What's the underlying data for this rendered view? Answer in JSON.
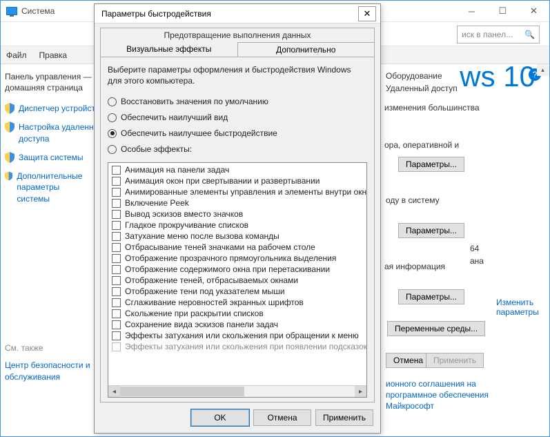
{
  "bg": {
    "title": "Система",
    "search_placeholder": "иск в панел...",
    "menu": {
      "file": "Файл",
      "edit": "Правка"
    },
    "left": {
      "home": "Панель управления —\nдомашняя страница",
      "items": [
        "Диспетчер устройств",
        "Настройка удаленного\nдоступа",
        "Защита системы",
        "Дополнительные параметры\nсистемы"
      ],
      "seealso": "См. также",
      "bottom": "Центр безопасности и\nобслуживания"
    },
    "right": {
      "tabs": [
        "Оборудование",
        "Удаленный доступ"
      ],
      "snip1": "изменения большинства",
      "snip2": "ора, оперативной и",
      "btn1": "Параметры...",
      "snip3": "оду в систему",
      "btn2": "Параметры...",
      "snip4": "ая информация",
      "btn3": "Параметры...",
      "snip5": "64",
      "snip6": "ана",
      "link_change": "Изменить\nпараметры",
      "env_btn": "Переменные среды...",
      "apply_cancel": "Отмена",
      "apply_apply": "Применить",
      "license1": "ионного соглашения на",
      "license2": "программное обеспечения",
      "license3": "Майкрософт",
      "w10": "ws 10"
    }
  },
  "modal": {
    "title": "Параметры быстродействия",
    "tab_dep": "Предотвращение выполнения данных",
    "tab_visual": "Визуальные эффекты",
    "tab_adv": "Дополнительно",
    "desc": "Выберите параметры оформления и быстродействия Windows для этого компьютера.",
    "radios": [
      {
        "label": "Восстановить значения по умолчанию",
        "checked": false
      },
      {
        "label": "Обеспечить наилучший вид",
        "checked": false
      },
      {
        "label": "Обеспечить наилучшее быстродействие",
        "checked": true
      },
      {
        "label": "Особые эффекты:",
        "checked": false
      }
    ],
    "checks": [
      "Анимация на панели задач",
      "Анимация окон при свертывании и развертывании",
      "Анимированные элементы управления и элементы внутри окна",
      "Включение Peek",
      "Вывод эскизов вместо значков",
      "Гладкое прокручивание списков",
      "Затухание меню после вызова команды",
      "Отбрасывание теней значками на рабочем столе",
      "Отображение прозрачного прямоугольника выделения",
      "Отображение содержимого окна при перетаскивании",
      "Отображение теней, отбрасываемых окнами",
      "Отображение тени под указателем мыши",
      "Сглаживание неровностей экранных шрифтов",
      "Скольжение при раскрытии списков",
      "Сохранение вида эскизов панели задач",
      "Эффекты затухания или скольжения при обращении к меню",
      "Эффекты затухания или скольжения при появлении подсказок"
    ],
    "ok": "OK",
    "cancel": "Отмена",
    "apply": "Применить"
  }
}
